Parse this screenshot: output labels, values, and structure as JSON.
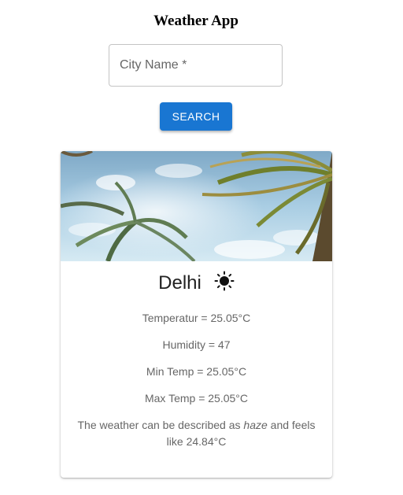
{
  "app": {
    "title": "Weather App"
  },
  "search": {
    "label": "City Name *",
    "value": "",
    "button_label": "SEARCH"
  },
  "card": {
    "image_icon": "palm-tree-sky-photo",
    "city": "Delhi",
    "weather_icon": "sun-icon",
    "temperature": "Temperatur = 25.05°C",
    "humidity": "Humidity = 47",
    "min_temp": "Min Temp = 25.05°C",
    "max_temp": "Max Temp = 25.05°C",
    "description_prefix": "The weather can be described as ",
    "description_condition": "haze",
    "description_suffix": " and feels like 24.84°C"
  },
  "colors": {
    "primary": "#1976d2",
    "text_secondary": "#666666"
  }
}
